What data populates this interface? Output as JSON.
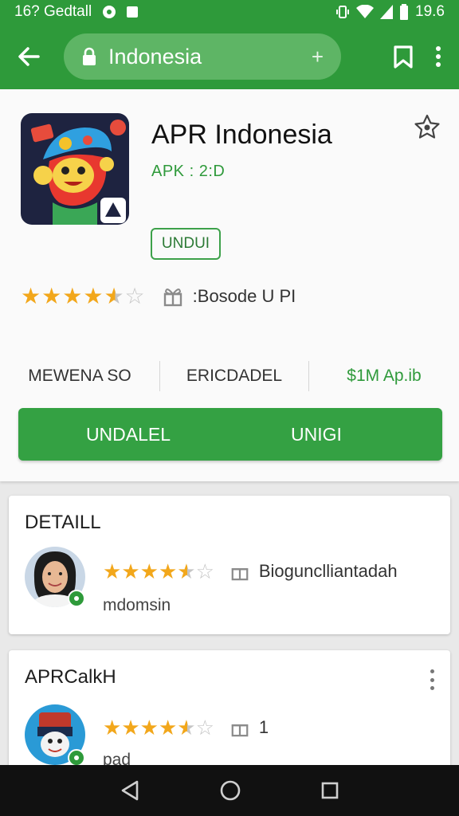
{
  "status_bar": {
    "left_text": "16? Gedtall",
    "time": "19.6",
    "color": "#2e9a3a"
  },
  "browser": {
    "url_text": "Indonesia",
    "plus_glyph": "+",
    "icons": [
      "back-arrow-icon",
      "lock-icon",
      "bookmark-icon",
      "more-vert-icon"
    ]
  },
  "app": {
    "title": "APR Indonesia",
    "version": "APK : 2:D",
    "download_chip": "UNDUI",
    "rating": 4.5,
    "rating_text": ":Bosode U PI",
    "meta": {
      "col1": "MEWENA SO",
      "col2": "ERICDADEL",
      "col3": "$1M Ap.ib"
    },
    "primary_button": {
      "left_label": "UNDALEL",
      "right_label": "UNIGI"
    },
    "accent_color": "#34a143"
  },
  "cards": [
    {
      "title": "DETAILL",
      "rating": 4.5,
      "review_label": "Biogunclliantadah",
      "review_sub": "mdomsin"
    },
    {
      "title": "APRCalkH",
      "rating": 4.5,
      "review_label": "1",
      "review_sub": "pad"
    }
  ],
  "nav": {
    "icons": [
      "back-triangle-icon",
      "home-circle-icon",
      "recents-square-icon"
    ]
  }
}
